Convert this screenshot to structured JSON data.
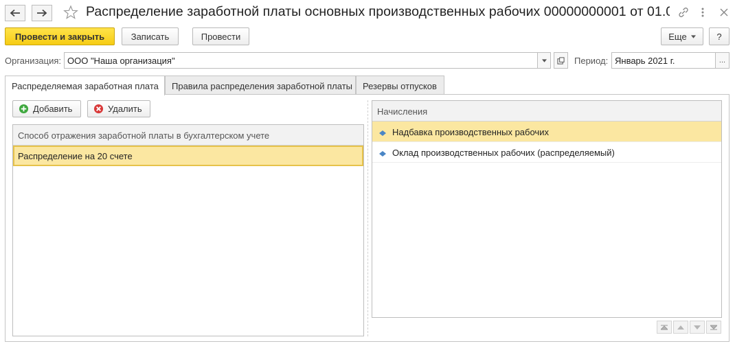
{
  "window": {
    "title": "Распределение заработной платы основных производственных рабочих 00000000001 от 01.0..."
  },
  "toolbar": {
    "post_close_label": "Провести и закрыть",
    "save_label": "Записать",
    "post_label": "Провести",
    "more_label": "Еще",
    "help_label": "?"
  },
  "form": {
    "org_label": "Организация:",
    "org_value": "ООО \"Наша организация\"",
    "period_label": "Период:",
    "period_value": "Январь 2021 г.",
    "select_btn": "..."
  },
  "tabs": [
    {
      "label": "Распределяемая заработная плата",
      "active": true
    },
    {
      "label": "Правила распределения заработной платы",
      "active": false
    },
    {
      "label": "Резервы отпусков",
      "active": false
    }
  ],
  "left_panel": {
    "add_label": "Добавить",
    "delete_label": "Удалить",
    "column_header": "Способ отражения заработной платы в бухгалтерском учете",
    "rows": [
      "Распределение на 20 счете"
    ]
  },
  "right_panel": {
    "column_header": "Начисления",
    "rows": [
      "Надбавка производственных рабочих",
      "Оклад производственных рабочих (распределяемый)"
    ]
  },
  "colors": {
    "accent_yellow": "#f6cc14",
    "selection": "#fbe7a1",
    "border": "#bdbdbd"
  },
  "icons": [
    "back-arrow-icon",
    "forward-arrow-icon",
    "star-icon",
    "link-icon",
    "menu-dots-icon",
    "maximize-icon",
    "close-icon",
    "add-icon",
    "delete-icon",
    "row-marker-icon",
    "chevron-down-icon",
    "open-icon"
  ]
}
